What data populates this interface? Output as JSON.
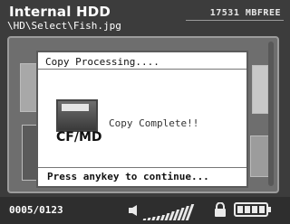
{
  "header": {
    "title": "Internal HDD",
    "free_space": "17531 MBFREE",
    "path": "\\HD\\Select\\Fish.jpg"
  },
  "dialog": {
    "title": "Copy Processing....",
    "device_label": "CF/MD",
    "message": "Copy Complete!!",
    "prompt": "Press anykey to continue..."
  },
  "status": {
    "counter": "0005/0123",
    "volume_icon": "speaker-icon",
    "lock_icon": "lock-icon",
    "battery_icon": "battery-icon"
  }
}
